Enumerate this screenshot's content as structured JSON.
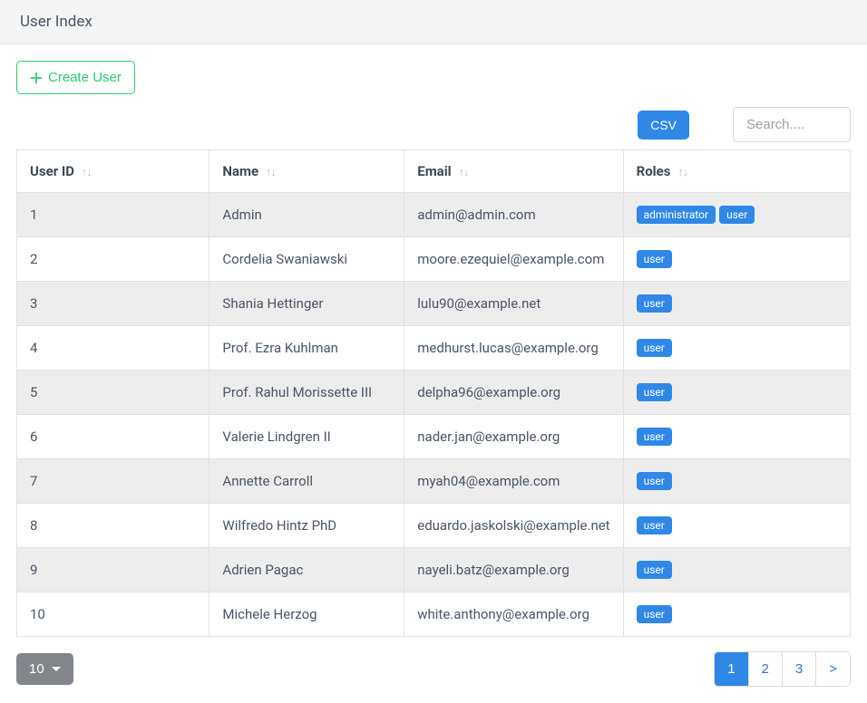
{
  "header": {
    "title": "User Index"
  },
  "actions": {
    "create_label": "Create User",
    "csv_label": "CSV",
    "search_placeholder": "Search....",
    "page_size_label": "10",
    "next_label": ">"
  },
  "table": {
    "columns": [
      {
        "key": "id",
        "label": "User ID"
      },
      {
        "key": "name",
        "label": "Name"
      },
      {
        "key": "email",
        "label": "Email"
      },
      {
        "key": "roles",
        "label": "Roles"
      }
    ],
    "rows": [
      {
        "id": "1",
        "name": "Admin",
        "email": "admin@admin.com",
        "roles": [
          "administrator",
          "user"
        ]
      },
      {
        "id": "2",
        "name": "Cordelia Swaniawski",
        "email": "moore.ezequiel@example.com",
        "roles": [
          "user"
        ]
      },
      {
        "id": "3",
        "name": "Shania Hettinger",
        "email": "lulu90@example.net",
        "roles": [
          "user"
        ]
      },
      {
        "id": "4",
        "name": "Prof. Ezra Kuhlman",
        "email": "medhurst.lucas@example.org",
        "roles": [
          "user"
        ]
      },
      {
        "id": "5",
        "name": "Prof. Rahul Morissette III",
        "email": "delpha96@example.org",
        "roles": [
          "user"
        ]
      },
      {
        "id": "6",
        "name": "Valerie Lindgren II",
        "email": "nader.jan@example.org",
        "roles": [
          "user"
        ]
      },
      {
        "id": "7",
        "name": "Annette Carroll",
        "email": "myah04@example.com",
        "roles": [
          "user"
        ]
      },
      {
        "id": "8",
        "name": "Wilfredo Hintz PhD",
        "email": "eduardo.jaskolski@example.net",
        "roles": [
          "user"
        ]
      },
      {
        "id": "9",
        "name": "Adrien Pagac",
        "email": "nayeli.batz@example.org",
        "roles": [
          "user"
        ]
      },
      {
        "id": "10",
        "name": "Michele Herzog",
        "email": "white.anthony@example.org",
        "roles": [
          "user"
        ]
      }
    ]
  },
  "pagination": {
    "pages": [
      "1",
      "2",
      "3"
    ],
    "active": 0
  }
}
